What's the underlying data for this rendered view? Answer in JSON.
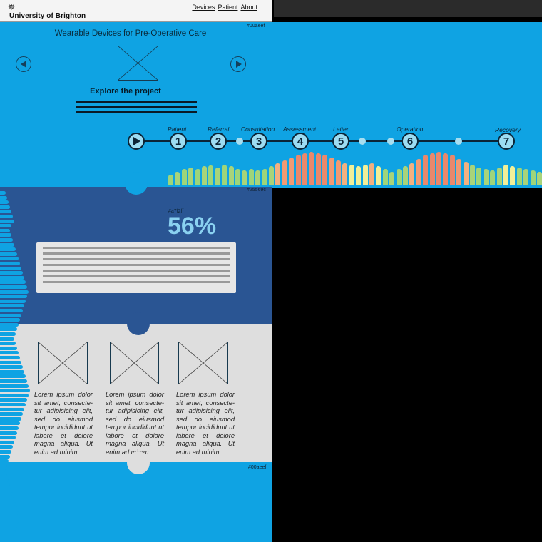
{
  "header": {
    "brand": "University of Brighton",
    "logo_icon": "star-logo-icon",
    "nav": [
      "Devices",
      "Patient",
      "About"
    ]
  },
  "hero": {
    "hex_label": "#00aeef",
    "title": "Wearable Devices for Pre-Operative Care",
    "explore_label": "Explore the project",
    "prev_icon": "arrow-left-icon",
    "next_icon": "arrow-right-icon",
    "timeline": {
      "steps": [
        {
          "number": "1",
          "label": "Patient"
        },
        {
          "number": "2",
          "label": "Referral"
        },
        {
          "number": "3",
          "label": "Consultation"
        },
        {
          "number": "4",
          "label": "Assessment"
        },
        {
          "number": "5",
          "label": "Letter"
        },
        {
          "number": "6",
          "label": "Operation"
        },
        {
          "number": "7",
          "label": "Recovery"
        }
      ]
    }
  },
  "stats": {
    "section_hex": "#25569c",
    "pct_hex": "#a7f2ff",
    "percentage": "56%"
  },
  "cards": [
    {
      "text": "Lorem ipsum dolor sit amet, consecte-tur adipisicing elit, sed do eiusmod tempor incididunt ut labore et dolore magna aliqua. Ut enim ad minim"
    },
    {
      "text": "Lorem ipsum dolor sit amet, consecte-tur adipisicing elit, sed do eiusmod tempor incididunt ut labore et dolore magna aliqua. Ut enim ad minim"
    },
    {
      "text": "Lorem ipsum dolor sit amet, consecte-tur adipisicing elit, sed do eiusmod tempor incididunt ut labore et dolore magna aliqua. Ut enim ad minim"
    }
  ],
  "bottom": {
    "hex_label": "#00aeef"
  },
  "colors": {
    "cyan": "#00aeef",
    "dark_blue": "#25569c",
    "light_blue": "#a7f2ff",
    "panel_grey": "#dedede"
  }
}
